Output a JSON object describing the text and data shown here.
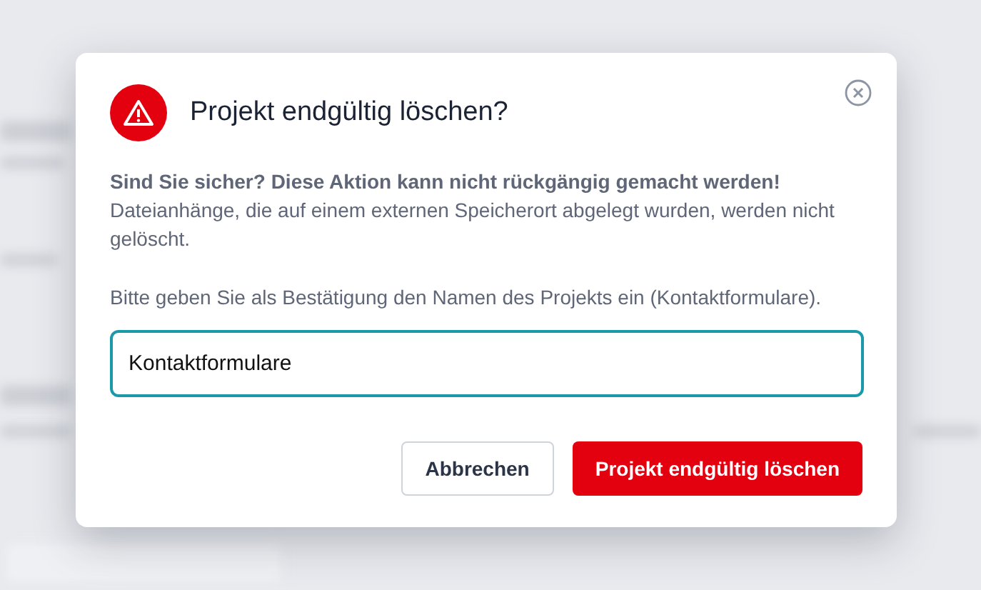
{
  "dialog": {
    "title": "Projekt endgültig löschen?",
    "warning": "Sind Sie sicher? Diese Aktion kann nicht rückgängig gemacht werden!",
    "message": "Dateianhänge, die auf einem externen Speicherort abgelegt wurden, werden nicht gelöscht.",
    "prompt": "Bitte geben Sie als Bestätigung den Namen des Projekts ein (Kontaktformulare).",
    "input": {
      "value": "Kontaktformulare"
    },
    "buttons": [
      {
        "label": "Abbrechen",
        "kind": "secondary"
      },
      {
        "label": "Projekt endgültig löschen",
        "kind": "danger"
      }
    ]
  }
}
